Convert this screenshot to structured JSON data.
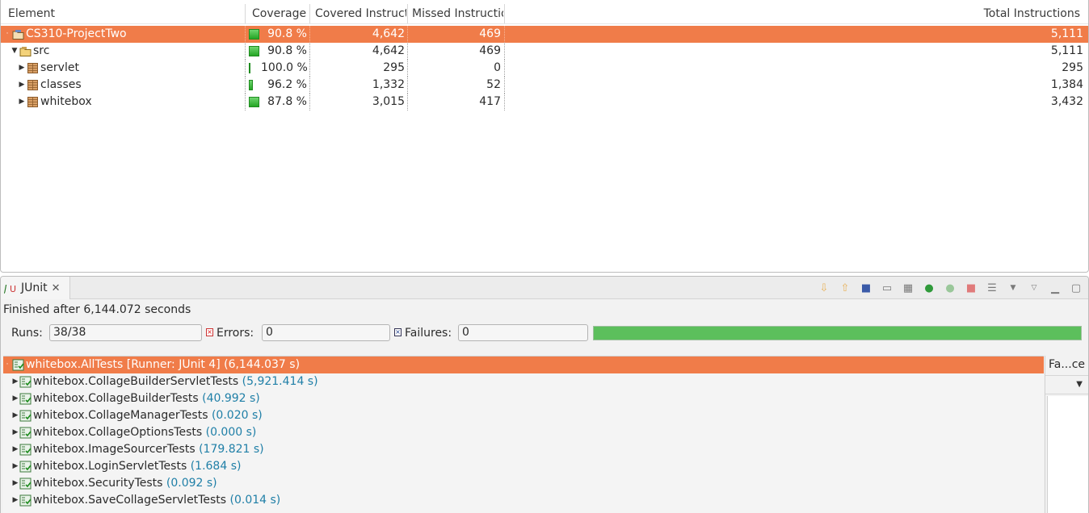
{
  "coverage": {
    "columns": {
      "element": "Element",
      "coverage": "Coverage",
      "covered": "Covered Instruct",
      "missed": "Missed Instructio",
      "total": "Total Instructions"
    },
    "rows": [
      {
        "name": "CS310-ProjectTwo",
        "coverage": "90.8 %",
        "coverage_value": 0.908,
        "covered": "4,642",
        "missed": "469",
        "total": "5,111",
        "icon": "project-icon"
      },
      {
        "name": "src",
        "coverage": "90.8 %",
        "coverage_value": 0.908,
        "covered": "4,642",
        "missed": "469",
        "total": "5,111",
        "icon": "source-folder-icon"
      },
      {
        "name": "servlet",
        "coverage": "100.0 %",
        "coverage_value": 1.0,
        "covered": "295",
        "missed": "0",
        "total": "295",
        "icon": "package-icon"
      },
      {
        "name": "classes",
        "coverage": "96.2 %",
        "coverage_value": 0.962,
        "covered": "1,332",
        "missed": "52",
        "total": "1,384",
        "icon": "package-icon"
      },
      {
        "name": "whitebox",
        "coverage": "87.8 %",
        "coverage_value": 0.878,
        "covered": "3,015",
        "missed": "417",
        "total": "3,432",
        "icon": "package-icon"
      }
    ]
  },
  "junit": {
    "tab_label": "JUnit",
    "status": "Finished after 6,144.072 seconds",
    "runs_label": "Runs:",
    "runs_value": "38/38",
    "errors_label": "Errors:",
    "errors_value": "0",
    "failures_label": "Failures:",
    "failures_value": "0",
    "progress": 1.0,
    "failure_trace_label": "Fa...ce",
    "tests": [
      {
        "name": "whitebox.AllTests [Runner: JUnit 4] (6,144.037 s)",
        "time": ""
      },
      {
        "name": "whitebox.CollageBuilderServletTests",
        "time": "(5,921.414 s)"
      },
      {
        "name": "whitebox.CollageBuilderTests",
        "time": "(40.992 s)"
      },
      {
        "name": "whitebox.CollageManagerTests",
        "time": "(0.020 s)"
      },
      {
        "name": "whitebox.CollageOptionsTests",
        "time": "(0.000 s)"
      },
      {
        "name": "whitebox.ImageSourcerTests",
        "time": "(179.821 s)"
      },
      {
        "name": "whitebox.LoginServletTests",
        "time": "(1.684 s)"
      },
      {
        "name": "whitebox.SecurityTests",
        "time": "(0.092 s)"
      },
      {
        "name": "whitebox.SaveCollageServletTests",
        "time": "(0.014 s)"
      }
    ]
  },
  "colors": {
    "selection": "#f07c49",
    "success": "#5cbf5c",
    "time_text": "#1f7fa7"
  }
}
